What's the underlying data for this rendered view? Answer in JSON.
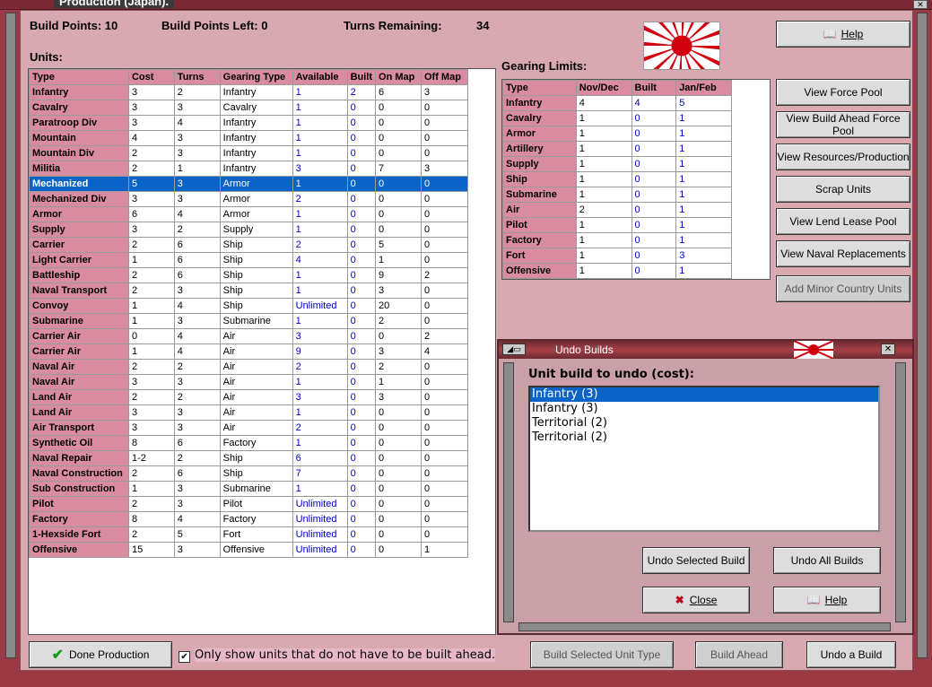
{
  "window": {
    "title": "Production (Japan)."
  },
  "stats": {
    "build_points": "Build Points: 10",
    "build_points_left": "Build Points Left: 0",
    "turns_remaining_label": "Turns Remaining:",
    "turns_remaining_value": "34"
  },
  "units": {
    "heading": "Units:",
    "columns": [
      "Type",
      "Cost",
      "Turns",
      "Gearing Type",
      "Available",
      "Built",
      "On Map",
      "Off Map"
    ],
    "rows": [
      [
        "Infantry",
        "3",
        "2",
        "Infantry",
        "1",
        "2",
        "6",
        "3"
      ],
      [
        "Cavalry",
        "3",
        "3",
        "Cavalry",
        "1",
        "0",
        "0",
        "0"
      ],
      [
        "Paratroop Div",
        "3",
        "4",
        "Infantry",
        "1",
        "0",
        "0",
        "0"
      ],
      [
        "Mountain",
        "4",
        "3",
        "Infantry",
        "1",
        "0",
        "0",
        "0"
      ],
      [
        "Mountain Div",
        "2",
        "3",
        "Infantry",
        "1",
        "0",
        "0",
        "0"
      ],
      [
        "Militia",
        "2",
        "1",
        "Infantry",
        "3",
        "0",
        "7",
        "3"
      ],
      [
        "Mechanized",
        "5",
        "3",
        "Armor",
        "1",
        "0",
        "0",
        "0"
      ],
      [
        "Mechanized Div",
        "3",
        "3",
        "Armor",
        "2",
        "0",
        "0",
        "0"
      ],
      [
        "Armor",
        "6",
        "4",
        "Armor",
        "1",
        "0",
        "0",
        "0"
      ],
      [
        "Supply",
        "3",
        "2",
        "Supply",
        "1",
        "0",
        "0",
        "0"
      ],
      [
        "Carrier",
        "2",
        "6",
        "Ship",
        "2",
        "0",
        "5",
        "0"
      ],
      [
        "Light Carrier",
        "1",
        "6",
        "Ship",
        "4",
        "0",
        "1",
        "0"
      ],
      [
        "Battleship",
        "2",
        "6",
        "Ship",
        "1",
        "0",
        "9",
        "2"
      ],
      [
        "Naval Transport",
        "2",
        "3",
        "Ship",
        "1",
        "0",
        "3",
        "0"
      ],
      [
        "Convoy",
        "1",
        "4",
        "Ship",
        "Unlimited",
        "0",
        "20",
        "0"
      ],
      [
        "Submarine",
        "1",
        "3",
        "Submarine",
        "1",
        "0",
        "2",
        "0"
      ],
      [
        "Carrier Air",
        "0",
        "4",
        "Air",
        "3",
        "0",
        "0",
        "2"
      ],
      [
        "Carrier Air",
        "1",
        "4",
        "Air",
        "9",
        "0",
        "3",
        "4"
      ],
      [
        "Naval Air",
        "2",
        "2",
        "Air",
        "2",
        "0",
        "2",
        "0"
      ],
      [
        "Naval Air",
        "3",
        "3",
        "Air",
        "1",
        "0",
        "1",
        "0"
      ],
      [
        "Land Air",
        "2",
        "2",
        "Air",
        "3",
        "0",
        "3",
        "0"
      ],
      [
        "Land Air",
        "3",
        "3",
        "Air",
        "1",
        "0",
        "0",
        "0"
      ],
      [
        "Air Transport",
        "3",
        "3",
        "Air",
        "2",
        "0",
        "0",
        "0"
      ],
      [
        "Synthetic Oil",
        "8",
        "6",
        "Factory",
        "1",
        "0",
        "0",
        "0"
      ],
      [
        "Naval Repair",
        "1-2",
        "2",
        "Ship",
        "6",
        "0",
        "0",
        "0"
      ],
      [
        "Naval Construction",
        "2",
        "6",
        "Ship",
        "7",
        "0",
        "0",
        "0"
      ],
      [
        "Sub Construction",
        "1",
        "3",
        "Submarine",
        "1",
        "0",
        "0",
        "0"
      ],
      [
        "Pilot",
        "2",
        "3",
        "Pilot",
        "Unlimited",
        "0",
        "0",
        "0"
      ],
      [
        "Factory",
        "8",
        "4",
        "Factory",
        "Unlimited",
        "0",
        "0",
        "0"
      ],
      [
        "1-Hexside Fort",
        "2",
        "5",
        "Fort",
        "Unlimited",
        "0",
        "0",
        "0"
      ],
      [
        "Offensive",
        "15",
        "3",
        "Offensive",
        "Unlimited",
        "0",
        "0",
        "1"
      ]
    ]
  },
  "gearing": {
    "heading": "Gearing Limits:",
    "columns": [
      "Type",
      "Nov/Dec",
      "Built",
      "Jan/Feb"
    ],
    "rows": [
      [
        "Infantry",
        "4",
        "4",
        "5"
      ],
      [
        "Cavalry",
        "1",
        "0",
        "1"
      ],
      [
        "Armor",
        "1",
        "0",
        "1"
      ],
      [
        "Artillery",
        "1",
        "0",
        "1"
      ],
      [
        "Supply",
        "1",
        "0",
        "1"
      ],
      [
        "Ship",
        "1",
        "0",
        "1"
      ],
      [
        "Submarine",
        "1",
        "0",
        "1"
      ],
      [
        "Air",
        "2",
        "0",
        "1"
      ],
      [
        "Pilot",
        "1",
        "0",
        "1"
      ],
      [
        "Factory",
        "1",
        "0",
        "1"
      ],
      [
        "Fort",
        "1",
        "0",
        "3"
      ],
      [
        "Offensive",
        "1",
        "0",
        "1"
      ]
    ]
  },
  "side_buttons": {
    "help": "Help",
    "view_force_pool": "View Force Pool",
    "view_build_ahead": "View Build Ahead Force Pool",
    "view_resources": "View Resources/Production",
    "scrap_units": "Scrap Units",
    "view_lend_lease": "View Lend Lease Pool",
    "view_naval_repl": "View Naval Replacements",
    "add_minor": "Add Minor Country Units"
  },
  "undo_dialog": {
    "title": "Undo Builds",
    "label": "Unit build to undo (cost):",
    "items": [
      "Infantry (3)",
      "Infantry (3)",
      "Territorial (2)",
      "Territorial (2)"
    ],
    "undo_selected": "Undo Selected Build",
    "undo_all": "Undo All Builds",
    "close": "Close",
    "help": "Help"
  },
  "bottom": {
    "done": "Done Production",
    "checkbox_label": "Only show units that do not have to be built ahead.",
    "build_selected": "Build Selected Unit Type",
    "build_ahead": "Build Ahead",
    "undo_build": "Undo a Build"
  },
  "colors": {
    "frame": "#d9a9b1",
    "row_header": "#d98ba0",
    "selection": "#0a64c8",
    "number_blue": "#0000c8"
  }
}
